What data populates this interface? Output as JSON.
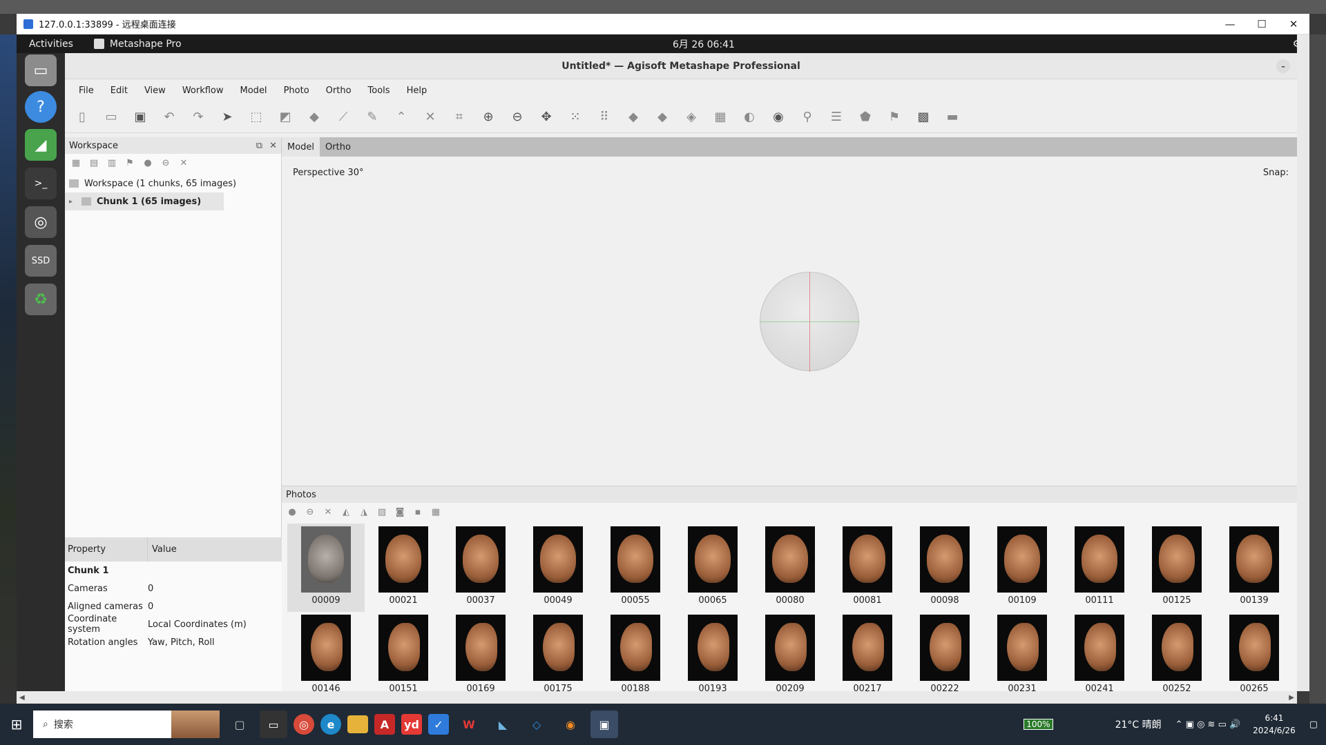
{
  "rdp": {
    "title": "127.0.0.1:33899 - 远程桌面连接",
    "controls": [
      "—",
      "☐",
      "✕"
    ]
  },
  "gnome": {
    "activities": "Activities",
    "app_name": "Metashape Pro",
    "clock": "6月 26  06:41"
  },
  "window": {
    "title": "Untitled* — Agisoft Metashape Professional"
  },
  "menu": [
    "File",
    "Edit",
    "View",
    "Workflow",
    "Model",
    "Photo",
    "Ortho",
    "Tools",
    "Help"
  ],
  "workspace": {
    "header": "Workspace",
    "root": "Workspace (1 chunks, 65 images)",
    "chunk": "Chunk 1 (65 images)"
  },
  "properties": {
    "col_property": "Property",
    "col_value": "Value",
    "title": "Chunk 1",
    "rows": [
      {
        "k": "Cameras",
        "v": "0"
      },
      {
        "k": "Aligned cameras",
        "v": "0"
      },
      {
        "k": "Coordinate system",
        "v": "Local Coordinates (m)"
      },
      {
        "k": "Rotation angles",
        "v": "Yaw, Pitch, Roll"
      }
    ]
  },
  "viewport": {
    "tabs": [
      "Model",
      "Ortho"
    ],
    "perspective": "Perspective 30°",
    "snap": "Snap:"
  },
  "photos": {
    "header": "Photos",
    "items": [
      "00009",
      "00021",
      "00037",
      "00049",
      "00055",
      "00065",
      "00080",
      "00081",
      "00098",
      "00109",
      "00111",
      "00125",
      "00139",
      "00146",
      "00151",
      "00169",
      "00175",
      "00188",
      "00193",
      "00209",
      "00217",
      "00222",
      "00231",
      "00241",
      "00252",
      "00265"
    ]
  },
  "taskbar": {
    "search": "搜索",
    "battery": "100%",
    "weather": "21°C  晴朗",
    "time": "6:41",
    "date": "2024/6/26"
  }
}
